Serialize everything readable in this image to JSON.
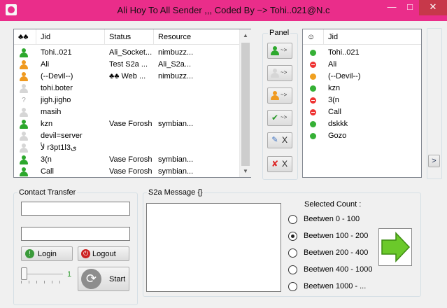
{
  "window": {
    "title": "Ali Hoy To All Sender  ,,, Coded By ~> Tohi..021@N.c",
    "minimize": "—",
    "maximize": "□",
    "close": "✕"
  },
  "contacts": {
    "columns": [
      "♣♣",
      "Jid",
      "Status",
      "Resource"
    ],
    "rows": [
      {
        "icon": "green-user-icon",
        "jid": "Tohi..021",
        "status": "Ali_Socket...",
        "resource": "nimbuzz..."
      },
      {
        "icon": "orange-user-icon",
        "jid": "Ali",
        "status": "Test S2a ...",
        "resource": "Ali_S2a..."
      },
      {
        "icon": "orange-user-icon",
        "jid": "(--Devil--)",
        "status": "♣♣ Web ...",
        "resource": "nimbuzz..."
      },
      {
        "icon": "gray-user-icon",
        "jid": "tohi.boter",
        "status": "",
        "resource": ""
      },
      {
        "icon": "unknown-icon",
        "jid": "jigh.jigho",
        "status": "",
        "resource": ""
      },
      {
        "icon": "gray-user-icon",
        "jid": "masih",
        "status": "",
        "resource": ""
      },
      {
        "icon": "green-user-icon",
        "jid": "kzn",
        "status": "Vase Forosh",
        "resource": "symbian..."
      },
      {
        "icon": "gray-user-icon",
        "jid": "devil=server",
        "status": "",
        "resource": ""
      },
      {
        "icon": "gray-user-icon",
        "jid": "ﻷ r3pt1l3ﻯ",
        "status": "",
        "resource": ""
      },
      {
        "icon": "green-user-icon",
        "jid": "3(n",
        "status": "Vase Forosh",
        "resource": "symbian..."
      },
      {
        "icon": "green-user-icon",
        "jid": "Call",
        "status": "Vase Forosh",
        "resource": "symbian..."
      }
    ]
  },
  "panel": {
    "label": "Panel",
    "buttons": [
      {
        "name": "send-green-user-button",
        "text": "~>"
      },
      {
        "name": "send-gray-user-button",
        "text": "~>"
      },
      {
        "name": "send-group-button",
        "text": "~>"
      },
      {
        "name": "send-checked-button",
        "text": "~>"
      },
      {
        "name": "clear-list-button",
        "text": "X"
      },
      {
        "name": "remove-selected-button",
        "text": "X"
      }
    ]
  },
  "selected": {
    "columns": [
      "☺",
      "Jid"
    ],
    "rows": [
      {
        "status": "green",
        "jid": "Tohi..021"
      },
      {
        "status": "red",
        "jid": "Ali"
      },
      {
        "status": "orange",
        "jid": "(--Devil--)"
      },
      {
        "status": "green",
        "jid": "kzn"
      },
      {
        "status": "red",
        "jid": "3(n"
      },
      {
        "status": "red",
        "jid": "Call"
      },
      {
        "status": "green",
        "jid": "dskkk"
      },
      {
        "status": "green",
        "jid": "Gozo"
      }
    ]
  },
  "side_button": ">",
  "transfer": {
    "label": "Contact Transfer",
    "username": "",
    "password": "",
    "login": "Login",
    "logout": "Logout",
    "slider_value": "1",
    "slider_level": 0,
    "start": "Start"
  },
  "message": {
    "label": "S2a Message {}",
    "text": "",
    "count_label": "Selected Count :",
    "options": [
      {
        "label": "Beetwen 0 - 100",
        "checked": false
      },
      {
        "label": "Beetwen 100 - 200",
        "checked": true
      },
      {
        "label": "Beetwen 200 - 400",
        "checked": false
      },
      {
        "label": "Beetwen 400 - 1000",
        "checked": false
      },
      {
        "label": "Beetwen 1000 - ...",
        "checked": false
      }
    ]
  }
}
